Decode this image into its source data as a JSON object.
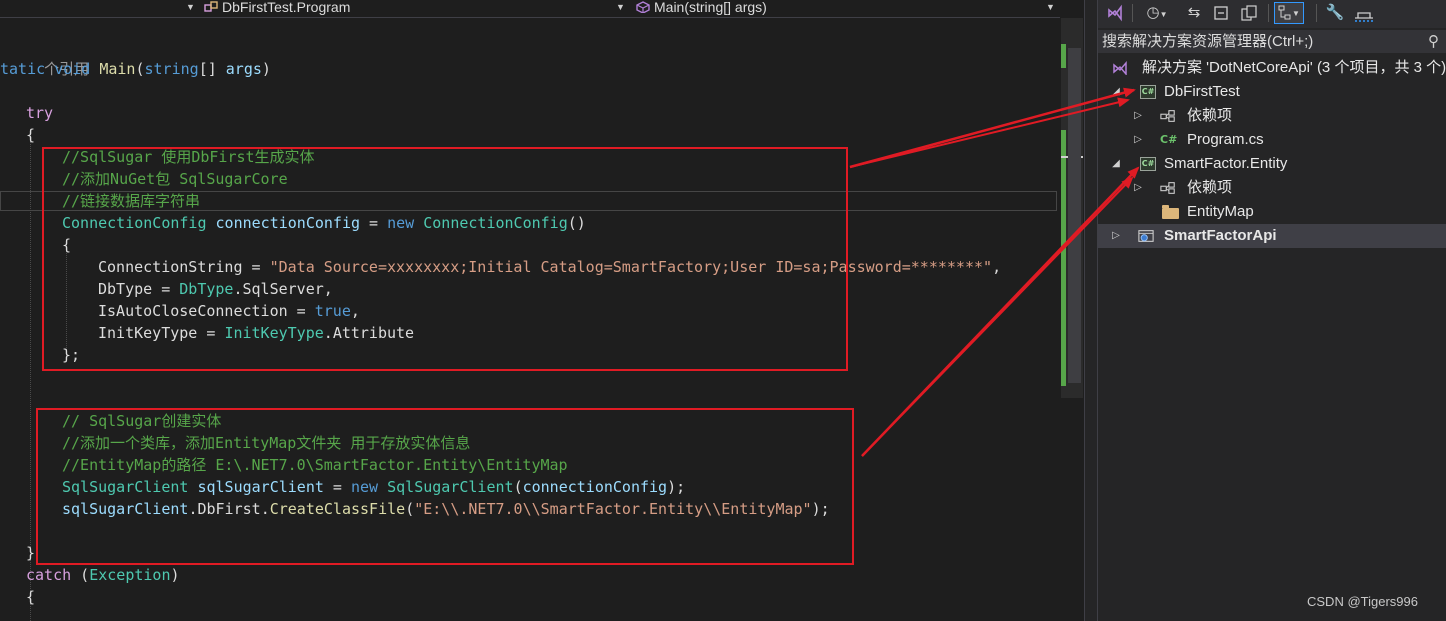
{
  "navbar": {
    "project_combo": "DbFirstTest.Program",
    "member_combo": "Main(string[] args)"
  },
  "code": {
    "codelens": "个引用",
    "signature": {
      "modifier": "tatic",
      "ret": "void",
      "name": "Main",
      "param_type": "string",
      "brackets": "[]",
      "param_name": "args"
    },
    "try_kw": "try",
    "comment1": "//SqlSugar 使用DbFirst生成实体",
    "comment2": "//添加NuGet包 SqlSugarCore",
    "comment3": "//链接数据库字符串",
    "config_type": "ConnectionConfig",
    "config_var": "connectionConfig",
    "new_kw": "new",
    "prop_conn": "ConnectionString",
    "conn_value": "\"Data Source=xxxxxxxx;Initial Catalog=SmartFactory;User ID=sa;Password=********\"",
    "prop_dbtype": "DbType",
    "dbtype_type": "DbType",
    "dbtype_member": "SqlServer",
    "prop_autoclose": "IsAutoCloseConnection",
    "true_kw": "true",
    "prop_initkey": "InitKeyType",
    "initkey_type": "InitKeyType",
    "initkey_member": "Attribute",
    "comment4": "// SqlSugar创建实体",
    "comment5": "//添加一个类库，添加EntityMap文件夹 用于存放实体信息",
    "comment6": "//EntityMap的路径 E:\\.NET7.0\\SmartFactor.Entity\\EntityMap",
    "client_type": "SqlSugarClient",
    "client_var": "sqlSugarClient",
    "client_call_var": "sqlSugarClient",
    "dbfirst": "DbFirst",
    "method": "CreateClassFile",
    "path_value": "\"E:\\\\.NET7.0\\\\SmartFactor.Entity\\\\EntityMap\"",
    "catch_kw": "catch",
    "exception_type": "Exception"
  },
  "solution": {
    "search_placeholder": "搜索解决方案资源管理器(Ctrl+;)",
    "items": [
      {
        "label": "解决方案 'DotNetCoreApi' (3 个项目，共 3 个)",
        "icon": "solution-icon"
      },
      {
        "label": "DbFirstTest",
        "icon": "csharp-project-icon",
        "badge": "C#"
      },
      {
        "label": "依赖项",
        "icon": "dependencies-icon"
      },
      {
        "label": "Program.cs",
        "icon": "csharp-file-icon",
        "badge": "C#"
      },
      {
        "label": "SmartFactor.Entity",
        "icon": "csharp-project-icon",
        "badge": "C#"
      },
      {
        "label": "依赖项",
        "icon": "dependencies-icon"
      },
      {
        "label": "EntityMap",
        "icon": "folder-icon"
      },
      {
        "label": "SmartFactorApi",
        "icon": "web-project-icon"
      }
    ]
  },
  "watermark": "CSDN @Tigers996",
  "colors": {
    "annotation_red": "#e01b24",
    "comment_green": "#57a64a",
    "keyword_blue": "#569cd6",
    "type_teal": "#4ec9b0"
  }
}
